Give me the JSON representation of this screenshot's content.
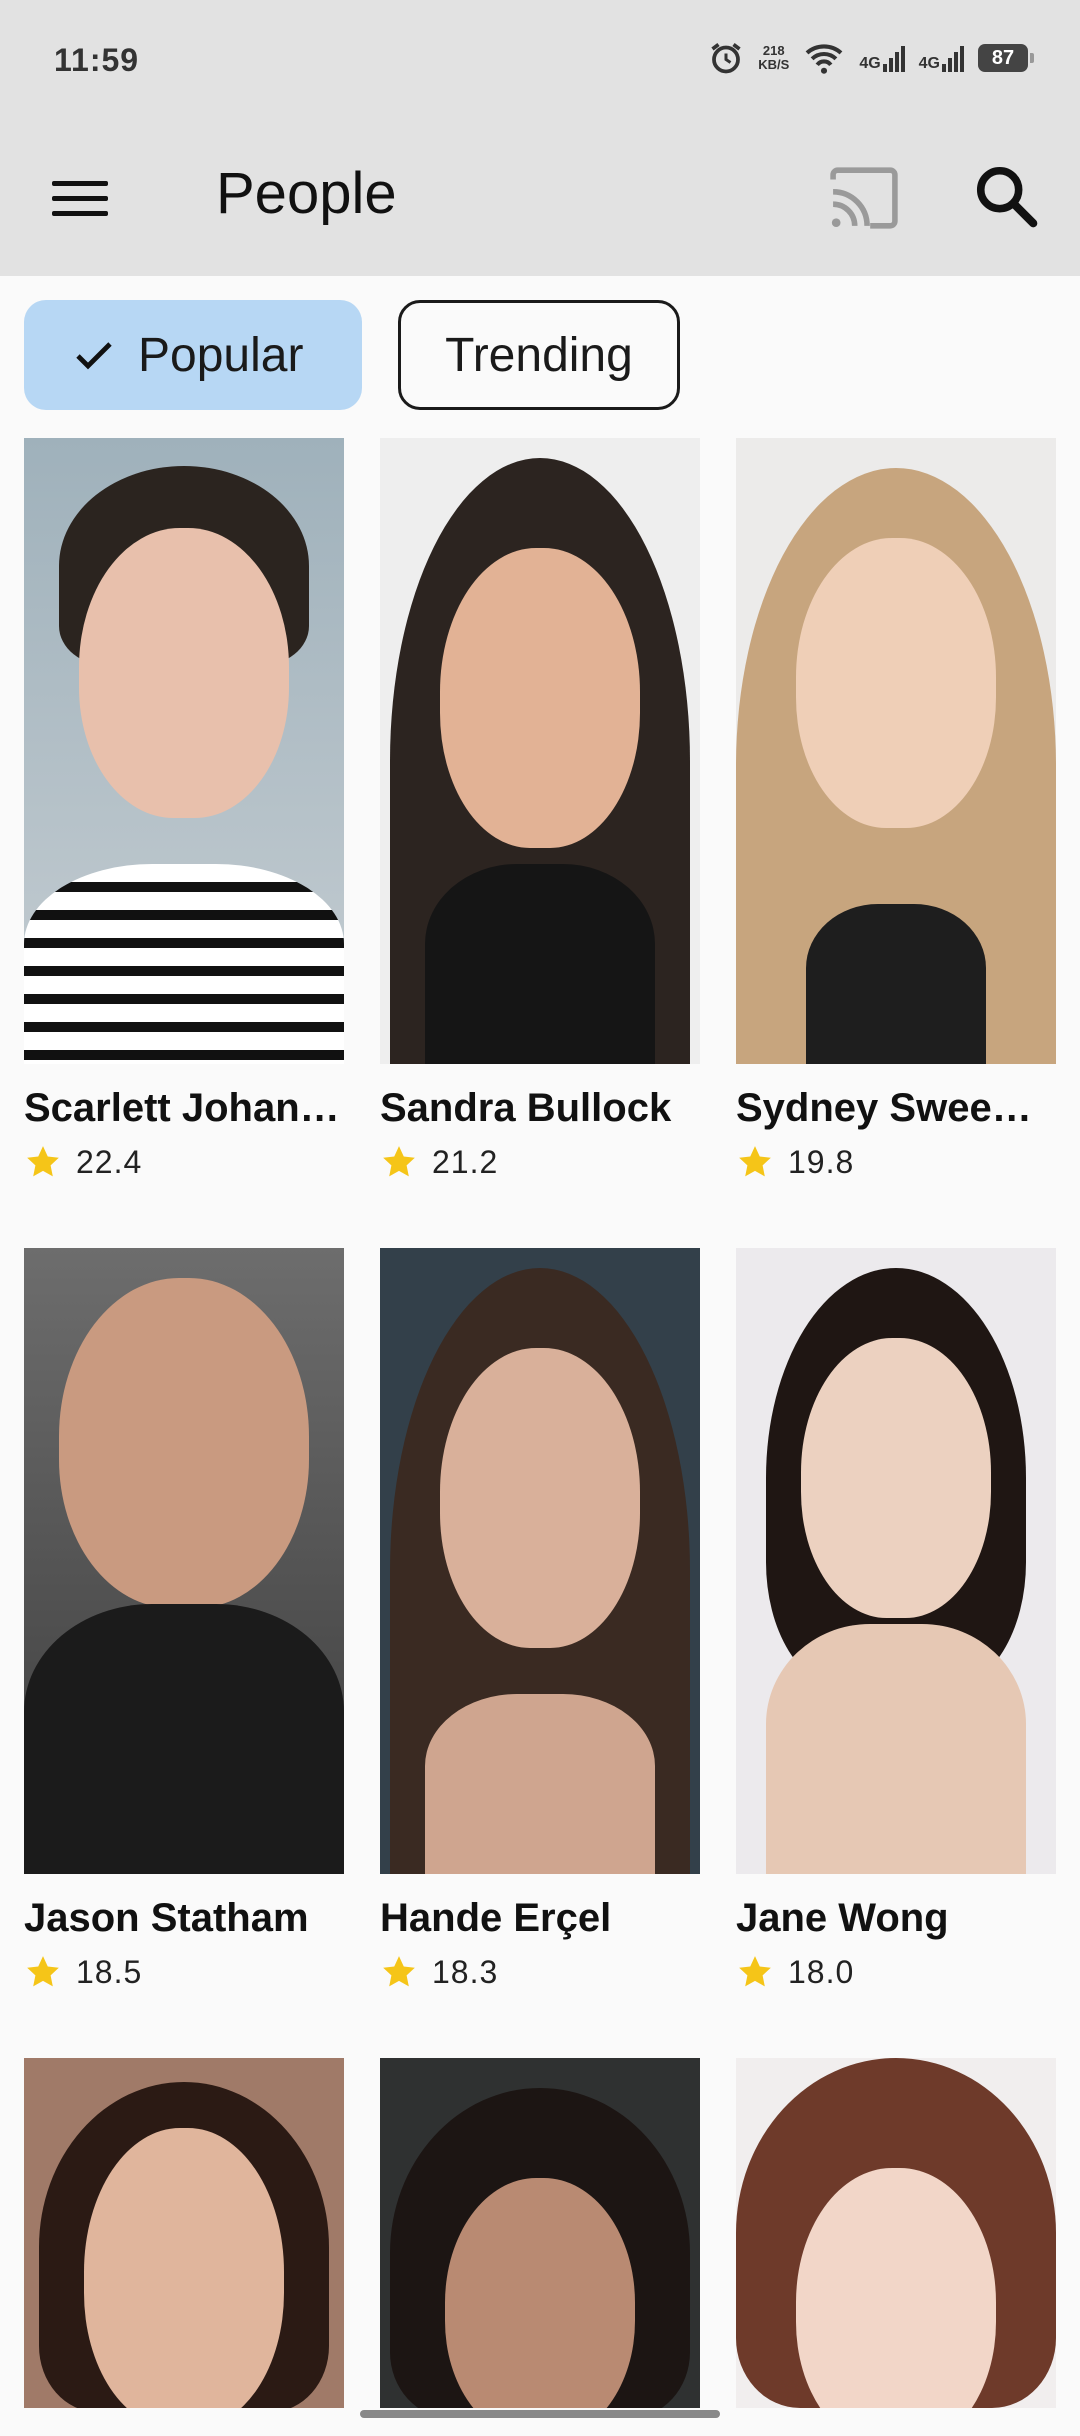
{
  "status_bar": {
    "time": "11:59",
    "speed_value": "218",
    "speed_unit": "KB/S",
    "net1": "4G",
    "net2": "4G",
    "battery": "87"
  },
  "app_bar": {
    "title": "People"
  },
  "chips": [
    {
      "label": "Popular",
      "selected": true
    },
    {
      "label": "Trending",
      "selected": false
    }
  ],
  "people": [
    {
      "name": "Scarlett Johansson",
      "score": "22.4"
    },
    {
      "name": "Sandra Bullock",
      "score": "21.2"
    },
    {
      "name": "Sydney Sweeney",
      "score": "19.8"
    },
    {
      "name": "Jason Statham",
      "score": "18.5"
    },
    {
      "name": "Hande Erçel",
      "score": "18.3"
    },
    {
      "name": "Jane Wong",
      "score": "18.0"
    },
    {
      "name": "",
      "score": ""
    },
    {
      "name": "",
      "score": ""
    },
    {
      "name": "",
      "score": ""
    }
  ],
  "colors": {
    "appbar": "#e2e2e2",
    "chip_selected": "#b7d7f4",
    "star": "#f5c518",
    "background": "#fafafa"
  }
}
